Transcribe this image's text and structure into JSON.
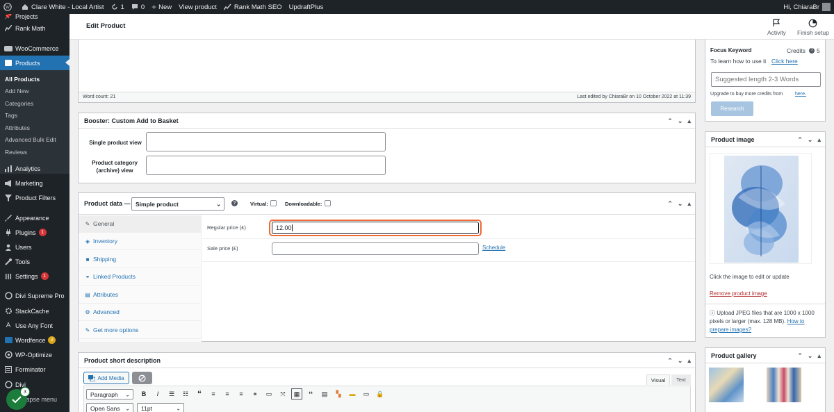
{
  "adminbar": {
    "site_name": "Clare White - Local Artist",
    "updates_count": "1",
    "comments_count": "0",
    "new_label": "New",
    "view_product": "View product",
    "rank_math": "Rank Math SEO",
    "updraft": "UpdraftPlus",
    "greeting": "Hi, ChiaraBr"
  },
  "sidebar": {
    "items": [
      {
        "label": "Projects",
        "icon": "pin-icon"
      },
      {
        "label": "Rank Math",
        "icon": "chart-icon"
      },
      {
        "label": "WooCommerce",
        "icon": "woo-icon"
      },
      {
        "label": "Products",
        "icon": "box-icon"
      },
      {
        "label": "Analytics",
        "icon": "bar-chart-icon"
      },
      {
        "label": "Marketing",
        "icon": "megaphone-icon"
      },
      {
        "label": "Product Filters",
        "icon": "filter-icon"
      },
      {
        "label": "Appearance",
        "icon": "brush-icon"
      },
      {
        "label": "Plugins",
        "icon": "plug-icon",
        "badge": "1"
      },
      {
        "label": "Users",
        "icon": "users-icon"
      },
      {
        "label": "Tools",
        "icon": "wrench-icon"
      },
      {
        "label": "Settings",
        "icon": "settings-icon",
        "badge": "1"
      },
      {
        "label": "Divi Supreme Pro",
        "icon": "divi-icon"
      },
      {
        "label": "StackCache",
        "icon": "gear-icon"
      },
      {
        "label": "Use Any Font",
        "icon": "font-icon"
      },
      {
        "label": "Wordfence",
        "icon": "shield-icon",
        "badge": "2"
      },
      {
        "label": "WP-Optimize",
        "icon": "optimize-icon"
      },
      {
        "label": "Forminator",
        "icon": "form-icon"
      },
      {
        "label": "Divi",
        "icon": "divi-icon"
      }
    ],
    "submenu": [
      "All Products",
      "Add New",
      "Categories",
      "Tags",
      "Attributes",
      "Advanced Bulk Edit",
      "Reviews"
    ],
    "collapse": "Collapse menu",
    "notification_count": "3"
  },
  "header": {
    "title": "Edit Product",
    "activity": "Activity",
    "finish_setup": "Finish setup"
  },
  "editor": {
    "word_count": "Word count: 21",
    "last_edited": "Last edited by ChiaraBr on 10 October 2022 at 11:39"
  },
  "booster": {
    "title": "Booster: Custom Add to Basket",
    "single_view": "Single product view",
    "category_view": "Product category (archive) view"
  },
  "product_data": {
    "title": "Product data —",
    "type": "Simple product",
    "virtual": "Virtual:",
    "downloadable": "Downloadable:",
    "tabs": [
      "General",
      "Inventory",
      "Shipping",
      "Linked Products",
      "Attributes",
      "Advanced",
      "Get more options"
    ],
    "regular_price_label": "Regular price (£)",
    "regular_price_value": "12.00",
    "sale_price_label": "Sale price (£)",
    "schedule": "Schedule"
  },
  "short_desc": {
    "title": "Product short description",
    "add_media": "Add Media",
    "visual": "Visual",
    "text": "Text",
    "paragraph": "Paragraph",
    "font_family": "Open Sans",
    "font_size": "11pt"
  },
  "rankmath_box": {
    "focus_keyword": "Focus Keyword",
    "credits": "Credits",
    "credits_count": "5",
    "learn_prefix": "To learn how to use it",
    "learn_link": "Click here",
    "placeholder": "Suggested length 2-3 Words",
    "upgrade_prefix": "Upgrade to buy more credits from",
    "upgrade_link": "here.",
    "research": "Research"
  },
  "product_image": {
    "title": "Product image",
    "click_hint": "Click the image to edit or update",
    "remove": "Remove product image",
    "upload_info": "Upload JPEG files that are 1000 x 1000 pixels or larger (max. 128 MB).",
    "how_to": "How to prepare images?"
  },
  "gallery": {
    "title": "Product gallery"
  }
}
